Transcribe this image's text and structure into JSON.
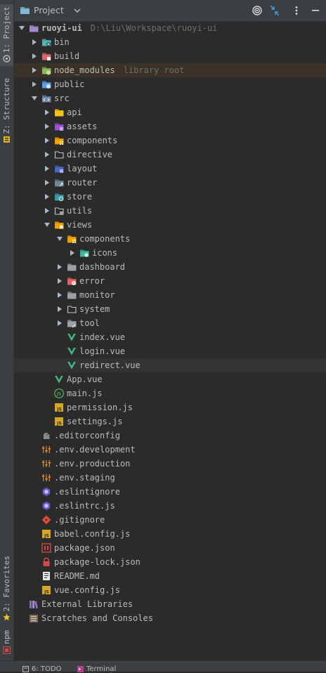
{
  "header": {
    "title": "Project"
  },
  "side_tabs": {
    "project": "1: Project",
    "structure": "Z: Structure",
    "favorites": "2: Favorites",
    "npm": "npm"
  },
  "bottom_tabs": {
    "todo": "6: TODO",
    "terminal": "Terminal"
  },
  "tree": [
    {
      "name": "ruoyi-ui",
      "hint": "D:\\Liu\\Workspace\\ruoyi-ui",
      "depth": 0,
      "arrow": "down",
      "icon": "folder-root",
      "bold": true
    },
    {
      "name": "bin",
      "depth": 1,
      "arrow": "right",
      "icon": "folder-teal"
    },
    {
      "name": "build",
      "depth": 1,
      "arrow": "right",
      "icon": "folder-red"
    },
    {
      "name": "node_modules",
      "hint": "library root",
      "depth": 1,
      "arrow": "right",
      "icon": "folder-node",
      "highlight": "lib"
    },
    {
      "name": "public",
      "depth": 1,
      "arrow": "right",
      "icon": "folder-blue"
    },
    {
      "name": "src",
      "depth": 1,
      "arrow": "down",
      "icon": "folder-src"
    },
    {
      "name": "api",
      "depth": 2,
      "arrow": "right",
      "icon": "folder-yellow"
    },
    {
      "name": "assets",
      "depth": 2,
      "arrow": "right",
      "icon": "folder-purple"
    },
    {
      "name": "components",
      "depth": 2,
      "arrow": "right",
      "icon": "folder-orange"
    },
    {
      "name": "directive",
      "depth": 2,
      "arrow": "right",
      "icon": "folder-outline"
    },
    {
      "name": "layout",
      "depth": 2,
      "arrow": "right",
      "icon": "folder-indigo"
    },
    {
      "name": "router",
      "depth": 2,
      "arrow": "right",
      "icon": "folder-slate"
    },
    {
      "name": "store",
      "depth": 2,
      "arrow": "right",
      "icon": "folder-teal2"
    },
    {
      "name": "utils",
      "depth": 2,
      "arrow": "right",
      "icon": "folder-outline2"
    },
    {
      "name": "views",
      "depth": 2,
      "arrow": "down",
      "icon": "folder-views"
    },
    {
      "name": "components",
      "depth": 3,
      "arrow": "down",
      "icon": "folder-orange"
    },
    {
      "name": "icons",
      "depth": 4,
      "arrow": "right",
      "icon": "folder-teal3"
    },
    {
      "name": "dashboard",
      "depth": 3,
      "arrow": "right",
      "icon": "folder-gray"
    },
    {
      "name": "error",
      "depth": 3,
      "arrow": "right",
      "icon": "folder-error"
    },
    {
      "name": "monitor",
      "depth": 3,
      "arrow": "right",
      "icon": "folder-gray"
    },
    {
      "name": "system",
      "depth": 3,
      "arrow": "right",
      "icon": "folder-outline"
    },
    {
      "name": "tool",
      "depth": 3,
      "arrow": "right",
      "icon": "folder-tool"
    },
    {
      "name": "index.vue",
      "depth": 3,
      "arrow": "none",
      "icon": "vue-file"
    },
    {
      "name": "login.vue",
      "depth": 3,
      "arrow": "none",
      "icon": "vue-file"
    },
    {
      "name": "redirect.vue",
      "depth": 3,
      "arrow": "none",
      "icon": "vue-file",
      "highlight": "sel"
    },
    {
      "name": "App.vue",
      "depth": 2,
      "arrow": "none",
      "icon": "vue-file"
    },
    {
      "name": "main.js",
      "depth": 2,
      "arrow": "none",
      "icon": "js-green"
    },
    {
      "name": "permission.js",
      "depth": 2,
      "arrow": "none",
      "icon": "js-file"
    },
    {
      "name": "settings.js",
      "depth": 2,
      "arrow": "none",
      "icon": "js-file"
    },
    {
      "name": ".editorconfig",
      "depth": 1,
      "arrow": "none",
      "icon": "editorconfig"
    },
    {
      "name": ".env.development",
      "depth": 1,
      "arrow": "none",
      "icon": "env-file"
    },
    {
      "name": ".env.production",
      "depth": 1,
      "arrow": "none",
      "icon": "env-file"
    },
    {
      "name": ".env.staging",
      "depth": 1,
      "arrow": "none",
      "icon": "env-file"
    },
    {
      "name": ".eslintignore",
      "depth": 1,
      "arrow": "none",
      "icon": "eslint"
    },
    {
      "name": ".eslintrc.js",
      "depth": 1,
      "arrow": "none",
      "icon": "eslint"
    },
    {
      "name": ".gitignore",
      "depth": 1,
      "arrow": "none",
      "icon": "git"
    },
    {
      "name": "babel.config.js",
      "depth": 1,
      "arrow": "none",
      "icon": "js-file"
    },
    {
      "name": "package.json",
      "depth": 1,
      "arrow": "none",
      "icon": "npm"
    },
    {
      "name": "package-lock.json",
      "depth": 1,
      "arrow": "none",
      "icon": "lock"
    },
    {
      "name": "README.md",
      "depth": 1,
      "arrow": "none",
      "icon": "markdown"
    },
    {
      "name": "vue.config.js",
      "depth": 1,
      "arrow": "none",
      "icon": "js-file"
    },
    {
      "name": "External Libraries",
      "depth": 0,
      "arrow": "none",
      "icon": "libraries"
    },
    {
      "name": "Scratches and Consoles",
      "depth": 0,
      "arrow": "none",
      "icon": "scratches"
    }
  ]
}
